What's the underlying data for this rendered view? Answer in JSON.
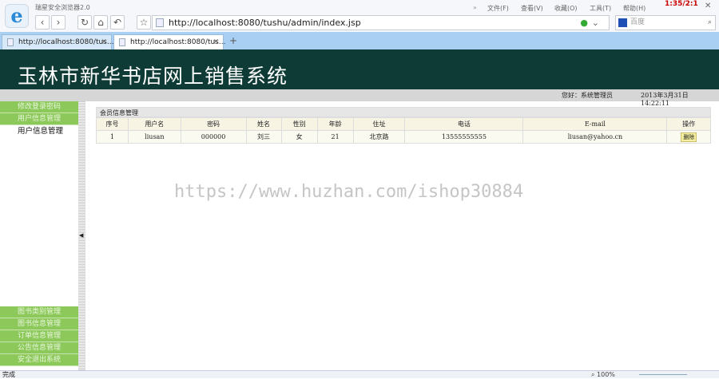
{
  "browser": {
    "title": "瑞星安全浏览器2.0",
    "url": "http://localhost:8080/tushu/admin/index.jsp",
    "search_placeholder": "百度",
    "menus": [
      "文件(F)",
      "查看(V)",
      "收藏(O)",
      "工具(T)",
      "帮助(H)"
    ],
    "clock": "1:35/2:1",
    "tabs": [
      {
        "label": "http://localhost:8080/tus..."
      },
      {
        "label": "http://localhost:8080/tus..."
      }
    ],
    "new_tab": "+",
    "status": "完成",
    "zoom": "100%"
  },
  "header": {
    "title": "玉林市新华书店网上销售系统",
    "greeting": "您好：系统管理员",
    "datetime": "2013年3月31日  14:22:11"
  },
  "sidebar": {
    "top_items": [
      "修改登录密码",
      "用户信息管理"
    ],
    "sub_item": "用户信息管理",
    "bottom_items": [
      "图书类别管理",
      "图书信息管理",
      "订单信息管理",
      "公告信息管理",
      "安全退出系统"
    ]
  },
  "panel": {
    "title": "会员信息管理",
    "columns": [
      "序号",
      "用户名",
      "密码",
      "姓名",
      "性别",
      "年龄",
      "住址",
      "电话",
      "E-mail",
      "操作"
    ],
    "rows": [
      {
        "id": "1",
        "username": "liusan",
        "password": "000000",
        "name": "刘三",
        "gender": "女",
        "age": "21",
        "address": "北京路",
        "phone": "13555555555",
        "email": "liusan@yahoo.cn",
        "action": "删除"
      }
    ]
  },
  "watermark": "https://www.huzhan.com/ishop30884"
}
